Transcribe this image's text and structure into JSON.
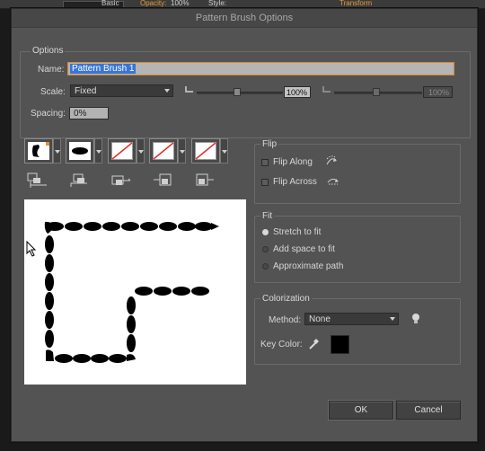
{
  "appbar": {
    "basic": "Basic",
    "opacity_label": "Opacity:",
    "opacity_value": "100%",
    "style_label": "Style:",
    "transform": "Transform"
  },
  "dialog": {
    "title": "Pattern Brush Options"
  },
  "options": {
    "title": "Options",
    "name_label": "Name:",
    "name_value": "Pattern Brush 1",
    "scale_label": "Scale:",
    "scale_value": "Fixed",
    "scale_min_pct": "100%",
    "scale_max_pct": "100%",
    "spacing_label": "Spacing:",
    "spacing_value": "0%"
  },
  "flip": {
    "title": "Flip",
    "along": "Flip Along",
    "across": "Flip Across"
  },
  "fit": {
    "title": "Fit",
    "stretch": "Stretch to fit",
    "add_space": "Add space to fit",
    "approx": "Approximate path",
    "selected": "stretch"
  },
  "colorization": {
    "title": "Colorization",
    "method_label": "Method:",
    "method_value": "None",
    "key_color_label": "Key Color:",
    "key_color": "#000000"
  },
  "buttons": {
    "ok": "OK",
    "cancel": "Cancel"
  }
}
